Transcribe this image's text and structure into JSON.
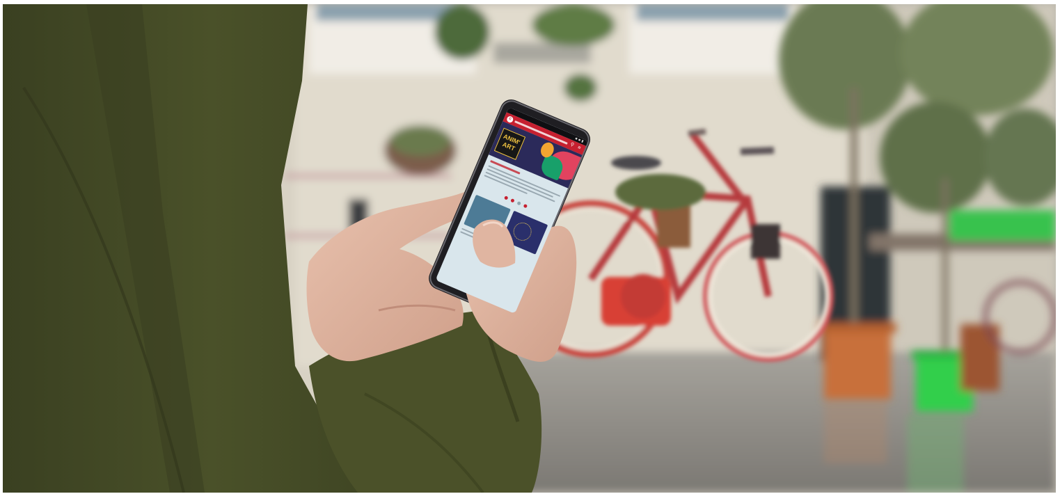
{
  "scene": {
    "subject": "person-holding-smartphone",
    "setting": "street-courtyard-with-bicycle"
  },
  "phone": {
    "site_logo_glyph": "C",
    "header_color": "#c62030",
    "banner_text_line1": "ANIM'",
    "banner_text_line2": "ART",
    "search_icon": "search-icon",
    "menu_icon": "menu-icon",
    "dot_colors": [
      "#c62030",
      "#c62030",
      "#8fa7b0",
      "#c62030"
    ]
  },
  "colors": {
    "jacket": "#444a27",
    "wall": "#dcd6c8",
    "bicycle": "#c63c3e",
    "planter_green": "#33cf4b",
    "planter_orange": "#c8703b",
    "pavement": "#8f8c86"
  }
}
